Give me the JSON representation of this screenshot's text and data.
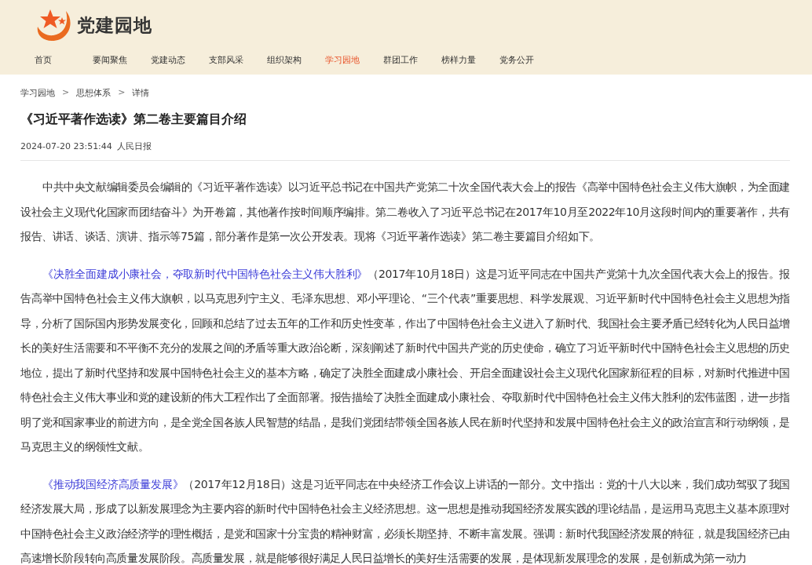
{
  "site": {
    "title": "党建园地"
  },
  "nav": [
    {
      "label": "首页",
      "selected": false
    },
    {
      "label": "要闻聚焦",
      "selected": false
    },
    {
      "label": "党建动态",
      "selected": false
    },
    {
      "label": "支部风采",
      "selected": false
    },
    {
      "label": "组织架构",
      "selected": false
    },
    {
      "label": "学习园地",
      "selected": true
    },
    {
      "label": "群团工作",
      "selected": false
    },
    {
      "label": "榜样力量",
      "selected": false
    },
    {
      "label": "党务公开",
      "selected": false
    }
  ],
  "breadcrumb": [
    {
      "kind": "link",
      "label": "学习园地"
    },
    {
      "kind": "separator",
      "label": ">"
    },
    {
      "kind": "link",
      "label": "思想体系"
    },
    {
      "kind": "separator",
      "label": ">"
    },
    {
      "kind": "link",
      "label": "详情"
    }
  ],
  "article": {
    "title": "《习近平著作选读》第二卷主要篇目介绍",
    "date": "2024-07-20 23:51:44",
    "source": "人民日报",
    "paragraphs": [
      {
        "text": "中共中央文献编辑委员会编辑的《习近平著作选读》以习近平总书记在中国共产党第二十次全国代表大会上的报告《高举中国特色社会主义伟大旗帜，为全面建设社会主义现代化国家而团结奋斗》为开卷篇，其他著作按时间顺序编排。第二卷收入了习近平总书记在2017年10月至2022年10月这段时间内的重要著作，共有报告、讲话、谈话、演讲、指示等75篇，部分著作是第一次公开发表。现将《习近平著作选读》第二卷主要篇目介绍如下。"
      },
      {
        "link": "《决胜全面建成小康社会，夺取新时代中国特色社会主义伟大胜利》",
        "text": "（2017年10月18日）这是习近平同志在中国共产党第十九次全国代表大会上的报告。报告高举中国特色社会主义伟大旗帜，以马克思列宁主义、毛泽东思想、邓小平理论、“三个代表”重要思想、科学发展观、习近平新时代中国特色社会主义思想为指导，分析了国际国内形势发展变化，回顾和总结了过去五年的工作和历史性变革，作出了中国特色社会主义进入了新时代、我国社会主要矛盾已经转化为人民日益增长的美好生活需要和不平衡不充分的发展之间的矛盾等重大政治论断，深刻阐述了新时代中国共产党的历史使命，确立了习近平新时代中国特色社会主义思想的历史地位，提出了新时代坚持和发展中国特色社会主义的基本方略，确定了决胜全面建成小康社会、开启全面建设社会主义现代化国家新征程的目标，对新时代推进中国特色社会主义伟大事业和党的建设新的伟大工程作出了全面部署。报告描绘了决胜全面建成小康社会、夺取新时代中国特色社会主义伟大胜利的宏伟蓝图，进一步指明了党和国家事业的前进方向，是全党全国各族人民智慧的结晶，是我们党团结带领全国各族人民在新时代坚持和发展中国特色社会主义的政治宣言和行动纲领，是马克思主义的纲领性文献。"
      },
      {
        "link": "《推动我国经济高质量发展》",
        "text": "（2017年12月18日）这是习近平同志在中央经济工作会议上讲话的一部分。文中指出：党的十八大以来，我们成功驾驭了我国经济发展大局，形成了以新发展理念为主要内容的新时代中国特色社会主义经济思想。这一思想是推动我国经济发展实践的理论结晶，是运用马克思主义基本原理对中国特色社会主义政治经济学的理性概括，是党和国家十分宝贵的精神财富，必须长期坚持、不断丰富发展。强调：新时代我国经济发展的特征，就是我国经济已由高速增长阶段转向高质量发展阶段。高质量发展，就是能够很好满足人民日益增长的美好生活需要的发展，是体现新发展理念的发展，是创新成为第一动力"
      }
    ]
  }
}
